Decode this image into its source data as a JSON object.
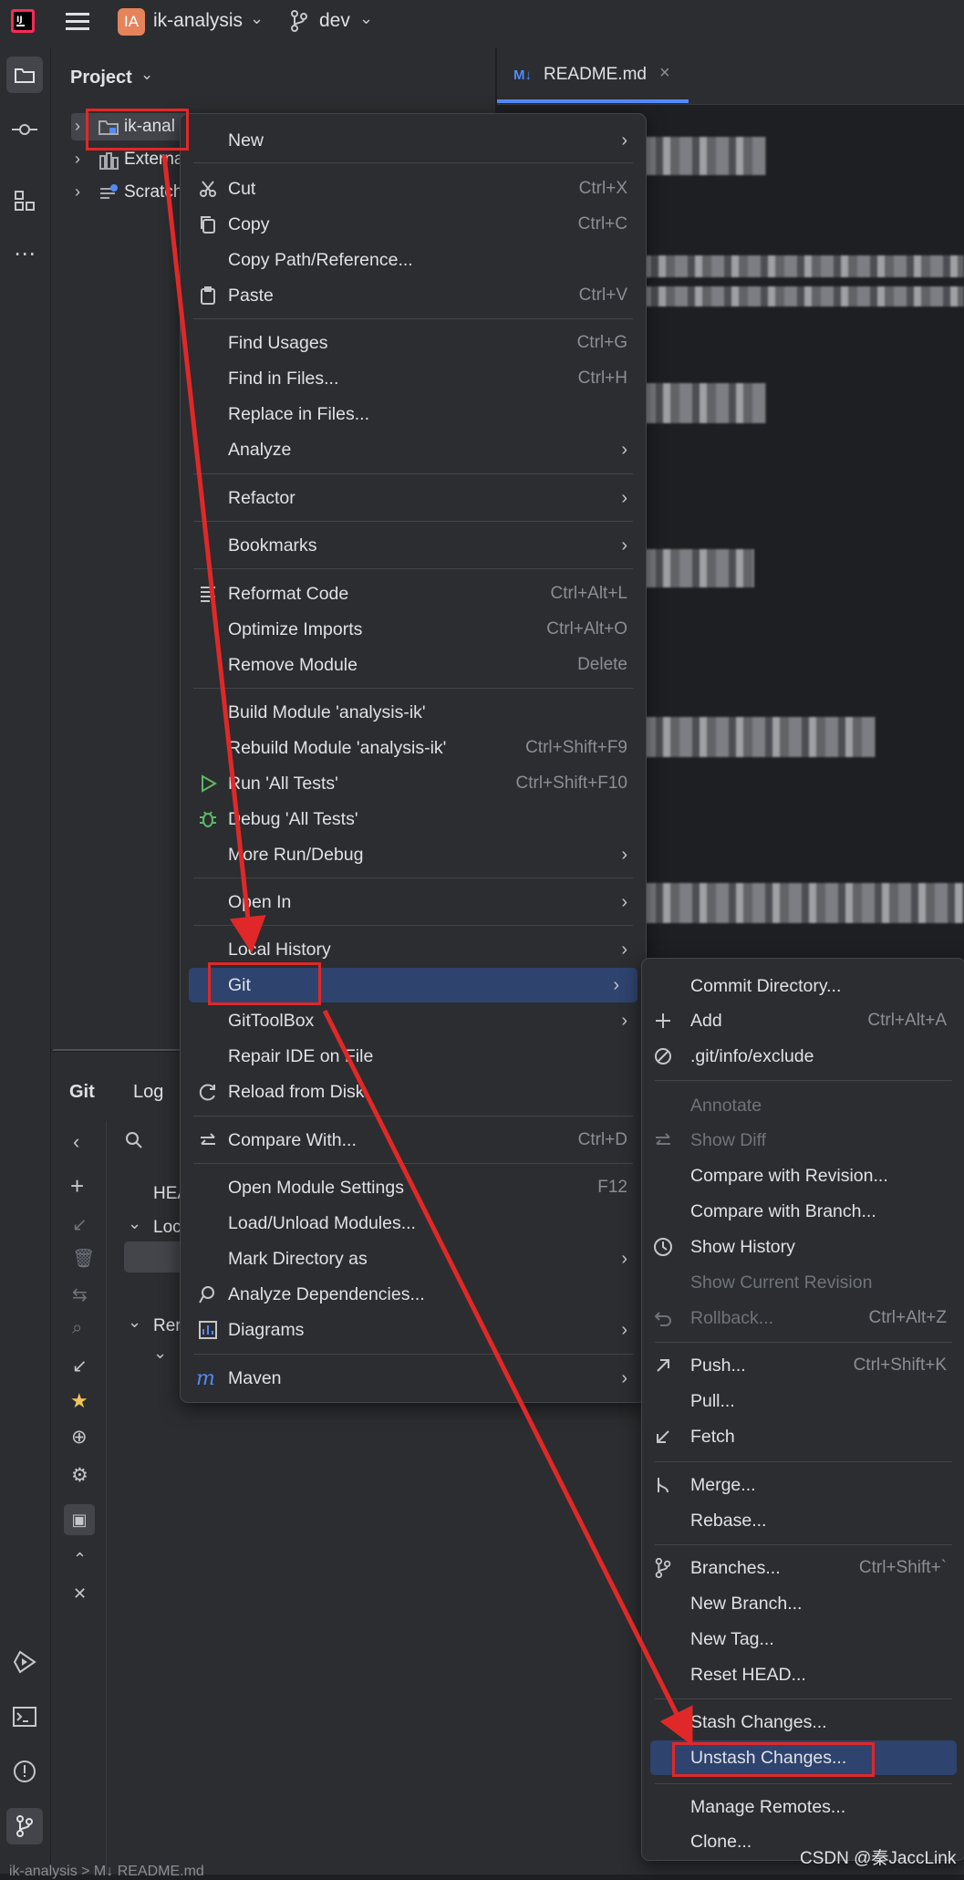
{
  "titlebar": {
    "project_badge": "IA",
    "project_name": "ik-analysis",
    "branch": "dev"
  },
  "project_panel": {
    "title": "Project",
    "tree": [
      {
        "label": "ik-anal"
      },
      {
        "label": "Externa"
      },
      {
        "label": "Scratch"
      }
    ]
  },
  "editor": {
    "tab": "README.md",
    "tab_badge": "M↓"
  },
  "git_panel": {
    "tabs": [
      "Git",
      "Log"
    ],
    "rows": [
      "HEA",
      "Loc",
      "Rer"
    ]
  },
  "context_menu": {
    "items": [
      {
        "label": "New",
        "shortcut": "",
        "submenu": true
      },
      {
        "label": "Cut",
        "shortcut": "Ctrl+X",
        "icon": "cut-icon"
      },
      {
        "label": "Copy",
        "shortcut": "Ctrl+C",
        "icon": "copy-icon"
      },
      {
        "label": "Copy Path/Reference...",
        "shortcut": ""
      },
      {
        "label": "Paste",
        "shortcut": "Ctrl+V",
        "icon": "paste-icon"
      },
      {
        "label": "Find Usages",
        "shortcut": "Ctrl+G"
      },
      {
        "label": "Find in Files...",
        "shortcut": "Ctrl+H"
      },
      {
        "label": "Replace in Files...",
        "shortcut": ""
      },
      {
        "label": "Analyze",
        "shortcut": "",
        "submenu": true
      },
      {
        "label": "Refactor",
        "shortcut": "",
        "submenu": true
      },
      {
        "label": "Bookmarks",
        "shortcut": "",
        "submenu": true
      },
      {
        "label": "Reformat Code",
        "shortcut": "Ctrl+Alt+L",
        "icon": "reformat-icon"
      },
      {
        "label": "Optimize Imports",
        "shortcut": "Ctrl+Alt+O"
      },
      {
        "label": "Remove Module",
        "shortcut": "Delete"
      },
      {
        "label": "Build Module 'analysis-ik'",
        "shortcut": ""
      },
      {
        "label": "Rebuild Module 'analysis-ik'",
        "shortcut": "Ctrl+Shift+F9"
      },
      {
        "label": "Run 'All Tests'",
        "shortcut": "Ctrl+Shift+F10",
        "icon": "run-icon"
      },
      {
        "label": "Debug 'All Tests'",
        "shortcut": "",
        "icon": "debug-icon"
      },
      {
        "label": "More Run/Debug",
        "shortcut": "",
        "submenu": true
      },
      {
        "label": "Open In",
        "shortcut": "",
        "submenu": true
      },
      {
        "label": "Local History",
        "shortcut": "",
        "submenu": true
      },
      {
        "label": "Git",
        "shortcut": "",
        "submenu": true
      },
      {
        "label": "GitToolBox",
        "shortcut": "",
        "submenu": true
      },
      {
        "label": "Repair IDE on File",
        "shortcut": ""
      },
      {
        "label": "Reload from Disk",
        "shortcut": "",
        "icon": "reload-icon"
      },
      {
        "label": "Compare With...",
        "shortcut": "Ctrl+D",
        "icon": "compare-icon"
      },
      {
        "label": "Open Module Settings",
        "shortcut": "F12"
      },
      {
        "label": "Load/Unload Modules...",
        "shortcut": ""
      },
      {
        "label": "Mark Directory as",
        "shortcut": "",
        "submenu": true
      },
      {
        "label": "Analyze Dependencies...",
        "shortcut": "",
        "icon": "dependencies-icon"
      },
      {
        "label": "Diagrams",
        "shortcut": "",
        "submenu": true,
        "icon": "diagrams-icon"
      },
      {
        "label": "Maven",
        "shortcut": "",
        "submenu": true,
        "icon": "maven-icon"
      }
    ]
  },
  "git_submenu": {
    "items": [
      {
        "label": "Commit Directory...",
        "shortcut": ""
      },
      {
        "label": "Add",
        "shortcut": "Ctrl+Alt+A",
        "icon": "plus-icon"
      },
      {
        "label": ".git/info/exclude",
        "shortcut": "",
        "icon": "ignore-icon"
      },
      {
        "label": "Annotate",
        "shortcut": "",
        "disabled": true
      },
      {
        "label": "Show Diff",
        "shortcut": "",
        "disabled": true,
        "icon": "diff-icon"
      },
      {
        "label": "Compare with Revision...",
        "shortcut": ""
      },
      {
        "label": "Compare with Branch...",
        "shortcut": ""
      },
      {
        "label": "Show History",
        "shortcut": "",
        "icon": "history-icon"
      },
      {
        "label": "Show Current Revision",
        "shortcut": "",
        "disabled": true
      },
      {
        "label": "Rollback...",
        "shortcut": "Ctrl+Alt+Z",
        "disabled": true,
        "icon": "rollback-icon"
      },
      {
        "label": "Push...",
        "shortcut": "Ctrl+Shift+K",
        "icon": "push-icon"
      },
      {
        "label": "Pull...",
        "shortcut": ""
      },
      {
        "label": "Fetch",
        "shortcut": "",
        "icon": "fetch-icon"
      },
      {
        "label": "Merge...",
        "shortcut": "",
        "icon": "merge-icon"
      },
      {
        "label": "Rebase...",
        "shortcut": ""
      },
      {
        "label": "Branches...",
        "shortcut": "Ctrl+Shift+`",
        "icon": "branch-icon"
      },
      {
        "label": "New Branch...",
        "shortcut": ""
      },
      {
        "label": "New Tag...",
        "shortcut": ""
      },
      {
        "label": "Reset HEAD...",
        "shortcut": ""
      },
      {
        "label": "Stash Changes...",
        "shortcut": ""
      },
      {
        "label": "Unstash Changes...",
        "shortcut": ""
      },
      {
        "label": "Manage Remotes...",
        "shortcut": ""
      },
      {
        "label": "Clone...",
        "shortcut": ""
      }
    ]
  },
  "watermark": "CSDN @秦JaccLink",
  "statusbar": {
    "path": "ik-analysis  >  M↓ README.md"
  },
  "colors": {
    "annotation": "#e02828",
    "selection": "#2e436e",
    "background": "#2b2d30"
  }
}
